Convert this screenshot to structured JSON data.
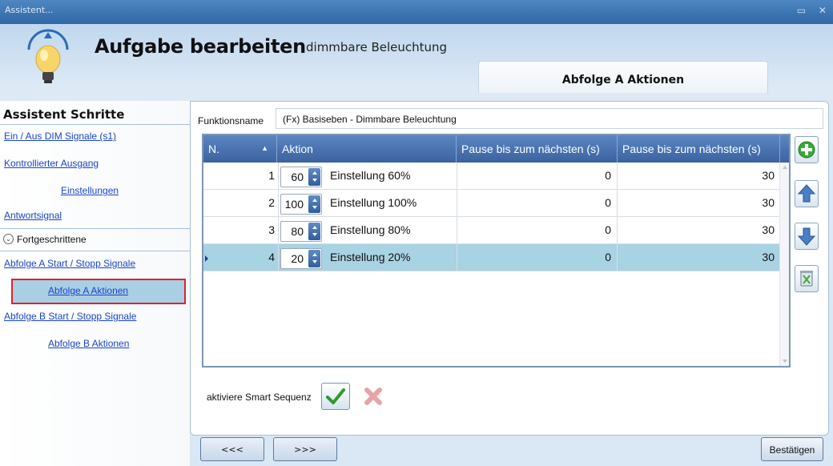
{
  "window": {
    "title": "Assistent..."
  },
  "header": {
    "title": "Aufgabe bearbeiten",
    "subtitle": "dimmbare Beleuchtung"
  },
  "tab": {
    "label": "Abfolge A Aktionen"
  },
  "sidebar": {
    "title": "Assistent Schritte",
    "items": [
      {
        "label": "Ein / Aus DIM Signale (s1)"
      },
      {
        "label": "Kontrollierter Ausgang"
      },
      {
        "label": "Einstellungen"
      },
      {
        "label": "Antwortsignal"
      },
      {
        "label": "Fortgeschrittene"
      },
      {
        "label": "Abfolge A Start / Stopp Signale"
      },
      {
        "label": "Abfolge A Aktionen"
      },
      {
        "label": "Abfolge B Start / Stopp Signale"
      },
      {
        "label": "Abfolge B Aktionen"
      }
    ]
  },
  "form": {
    "function_name_label": "Funktionsname",
    "function_name_value": "(Fx) Basiseben - Dimmbare Beleuchtung"
  },
  "grid": {
    "columns": [
      "N.",
      "Aktion",
      "Pause bis zum nächsten (s)",
      "Pause bis zum nächsten (s)"
    ],
    "rows": [
      {
        "n": "1",
        "level": "60",
        "desc": "Einstellung 60%",
        "pause1": "0",
        "pause2": "30"
      },
      {
        "n": "2",
        "level": "100",
        "desc": "Einstellung 100%",
        "pause1": "0",
        "pause2": "30"
      },
      {
        "n": "3",
        "level": "80",
        "desc": "Einstellung 80%",
        "pause1": "0",
        "pause2": "30"
      },
      {
        "n": "4",
        "level": "20",
        "desc": "Einstellung 20%",
        "pause1": "0",
        "pause2": "30"
      }
    ],
    "selected_row": 4
  },
  "smart": {
    "label": "aktiviere Smart Sequenz"
  },
  "nav": {
    "back": "<<<",
    "next": ">>>",
    "confirm": "Bestätigen"
  },
  "colors": {
    "accent": "#3a62a0",
    "selected_row": "#a8d3e2",
    "link": "#1a44c9",
    "highlight_border": "#e0222b"
  },
  "icons": [
    "bulb-icon",
    "add-icon",
    "arrow-up-icon",
    "arrow-down-icon",
    "delete-icon",
    "check-icon",
    "cancel-icon",
    "chevron-down-icon"
  ]
}
